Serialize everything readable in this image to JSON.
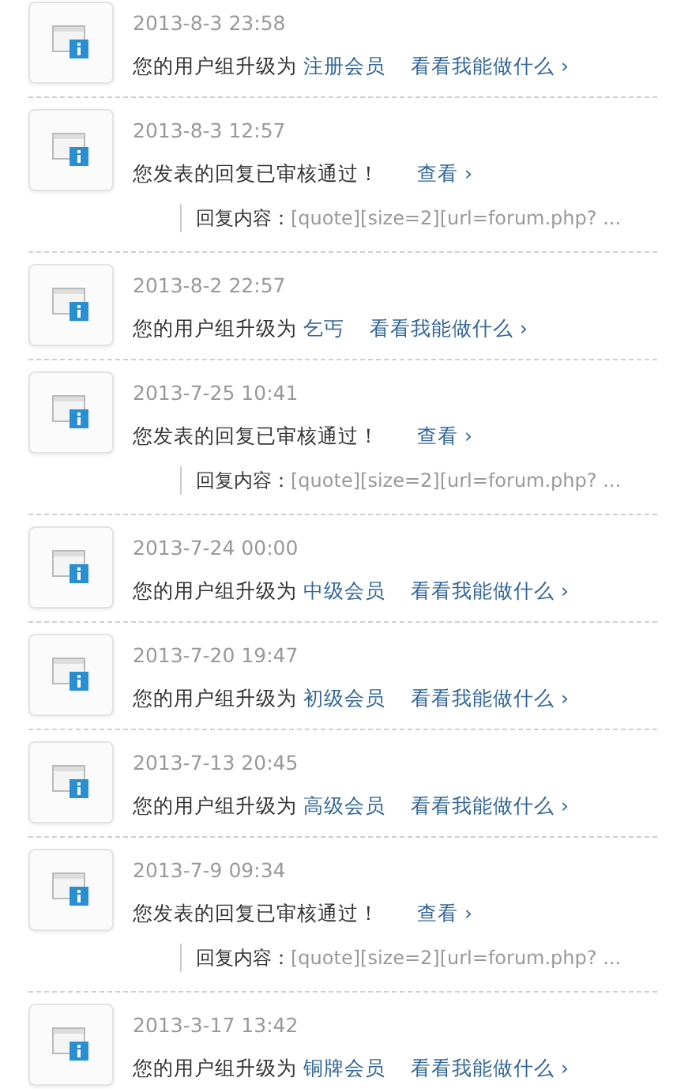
{
  "notifications": [
    {
      "kind": "upgrade",
      "time": "2013-8-3 23:58",
      "message": "您的用户组升级为",
      "group": "注册会员",
      "action": "看看我能做什么 ›"
    },
    {
      "kind": "reply",
      "time": "2013-8-3 12:57",
      "message": "您发表的回复已审核通过！",
      "action": "查看 ›",
      "quote_label": "回复内容：",
      "quote": "[quote][size=2][url=forum.php? ..."
    },
    {
      "kind": "upgrade",
      "time": "2013-8-2 22:57",
      "message": "您的用户组升级为",
      "group": "乞丐",
      "action": "看看我能做什么 ›"
    },
    {
      "kind": "reply",
      "time": "2013-7-25 10:41",
      "message": "您发表的回复已审核通过！",
      "action": "查看 ›",
      "quote_label": "回复内容：",
      "quote": "[quote][size=2][url=forum.php? ..."
    },
    {
      "kind": "upgrade",
      "time": "2013-7-24 00:00",
      "message": "您的用户组升级为",
      "group": "中级会员",
      "action": "看看我能做什么 ›"
    },
    {
      "kind": "upgrade",
      "time": "2013-7-20 19:47",
      "message": "您的用户组升级为",
      "group": "初级会员",
      "action": "看看我能做什么 ›"
    },
    {
      "kind": "upgrade",
      "time": "2013-7-13 20:45",
      "message": "您的用户组升级为",
      "group": "高级会员",
      "action": "看看我能做什么 ›"
    },
    {
      "kind": "reply",
      "time": "2013-7-9 09:34",
      "message": "您发表的回复已审核通过！",
      "action": "查看 ›",
      "quote_label": "回复内容：",
      "quote": "[quote][size=2][url=forum.php? ..."
    },
    {
      "kind": "upgrade",
      "time": "2013-3-17 13:42",
      "message": "您的用户组升级为",
      "group": "铜牌会员",
      "action": "看看我能做什么 ›"
    }
  ]
}
